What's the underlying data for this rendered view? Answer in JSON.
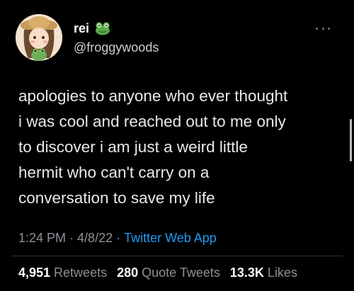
{
  "author": {
    "display_name": "rei",
    "handle": "@froggywoods",
    "avatar_icon": "frog-girl-avatar",
    "badge_icon": "frog-emoji-icon"
  },
  "tweet": {
    "text": "apologies to anyone who ever thought\ni was cool and reached out to me only\nto discover i am just a weird little\nhermit who can't carry on a\nconversation to save my life",
    "time": "1:24 PM",
    "date": "4/8/22",
    "source": "Twitter Web App"
  },
  "stats": {
    "retweets_count": "4,951",
    "retweets_label": "Retweets",
    "quotes_count": "280",
    "quotes_label": "Quote Tweets",
    "likes_count": "13.3K",
    "likes_label": "Likes"
  },
  "colors": {
    "background": "#000000",
    "text": "#e7e9ea",
    "secondary": "#8b9096",
    "link": "#1d9bf0"
  }
}
